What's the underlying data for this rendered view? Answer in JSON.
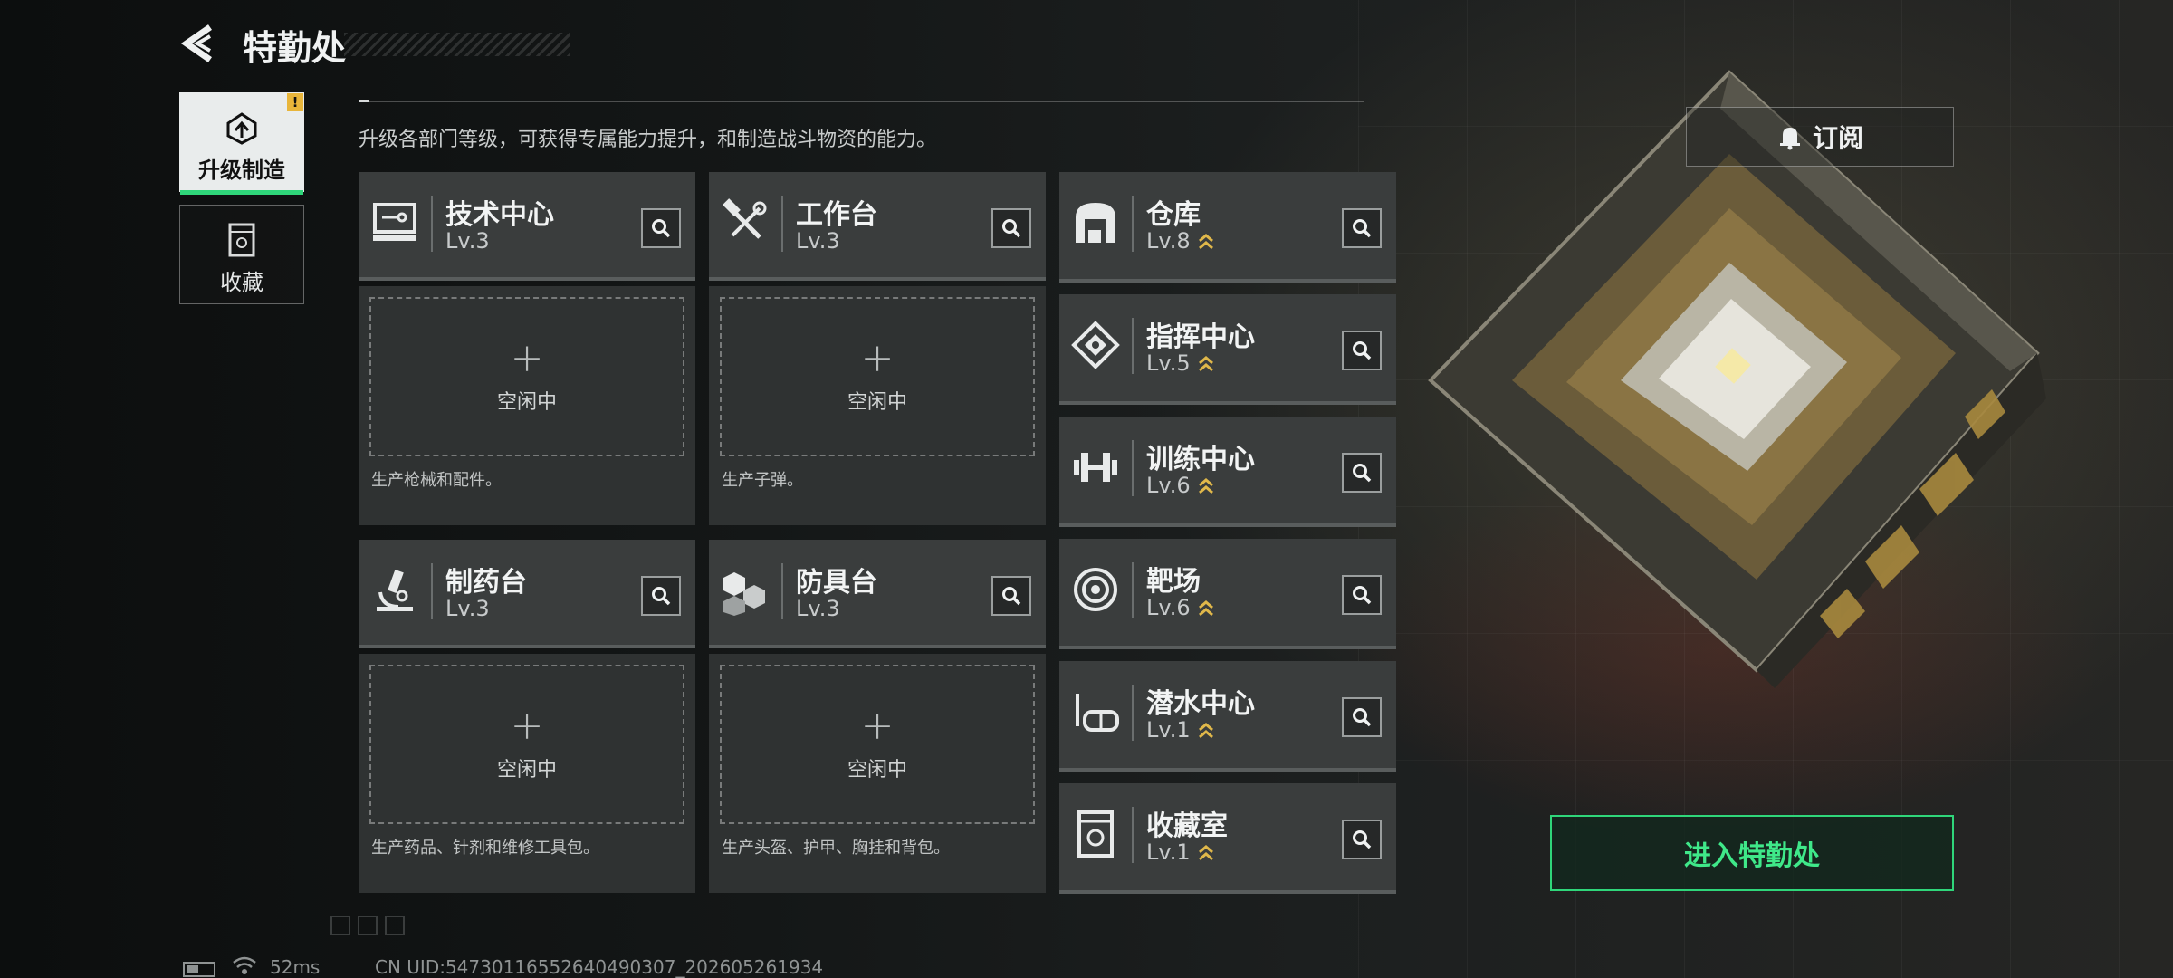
{
  "header": {
    "title": "特勤处",
    "description": "升级各部门等级，可获得专属能力提升，和制造战斗物资的能力。"
  },
  "nav": {
    "upgrade_label": "升级制造",
    "upgrade_badge": "!",
    "favorites_label": "收藏"
  },
  "subscribe_label": "订阅",
  "idle_label": "空闲中",
  "plus_symbol": "+",
  "production_cards": [
    {
      "name": "技术中心",
      "level": "Lv.3",
      "note": "生产枪械和配件。",
      "icon": "monitor-icon"
    },
    {
      "name": "工作台",
      "level": "Lv.3",
      "note": "生产子弹。",
      "icon": "hammer-wrench-icon"
    },
    {
      "name": "制药台",
      "level": "Lv.3",
      "note": "生产药品、针剂和维修工具包。",
      "icon": "microscope-icon"
    },
    {
      "name": "防具台",
      "level": "Lv.3",
      "note": "生产头盔、护甲、胸挂和背包。",
      "icon": "cubes-icon"
    }
  ],
  "departments": [
    {
      "name": "仓库",
      "level": "Lv.8",
      "upgradable": true,
      "icon": "warehouse-icon"
    },
    {
      "name": "指挥中心",
      "level": "Lv.5",
      "upgradable": true,
      "icon": "command-diamond-icon"
    },
    {
      "name": "训练中心",
      "level": "Lv.6",
      "upgradable": true,
      "icon": "dumbbell-icon"
    },
    {
      "name": "靶场",
      "level": "Lv.6",
      "upgradable": true,
      "icon": "target-icon"
    },
    {
      "name": "潜水中心",
      "level": "Lv.1",
      "upgradable": true,
      "icon": "diving-mask-icon"
    },
    {
      "name": "收藏室",
      "level": "Lv.1",
      "upgradable": true,
      "icon": "trophy-case-icon"
    }
  ],
  "enter_label": "进入特勤处",
  "status": {
    "ping": "52ms",
    "uid": "CN UID:5473011655264049030​7_202605261934"
  },
  "colors": {
    "accent_green": "#2fd67a",
    "warning_yellow": "#e8b53a",
    "upgrade_chevron": "#e0b84a"
  }
}
